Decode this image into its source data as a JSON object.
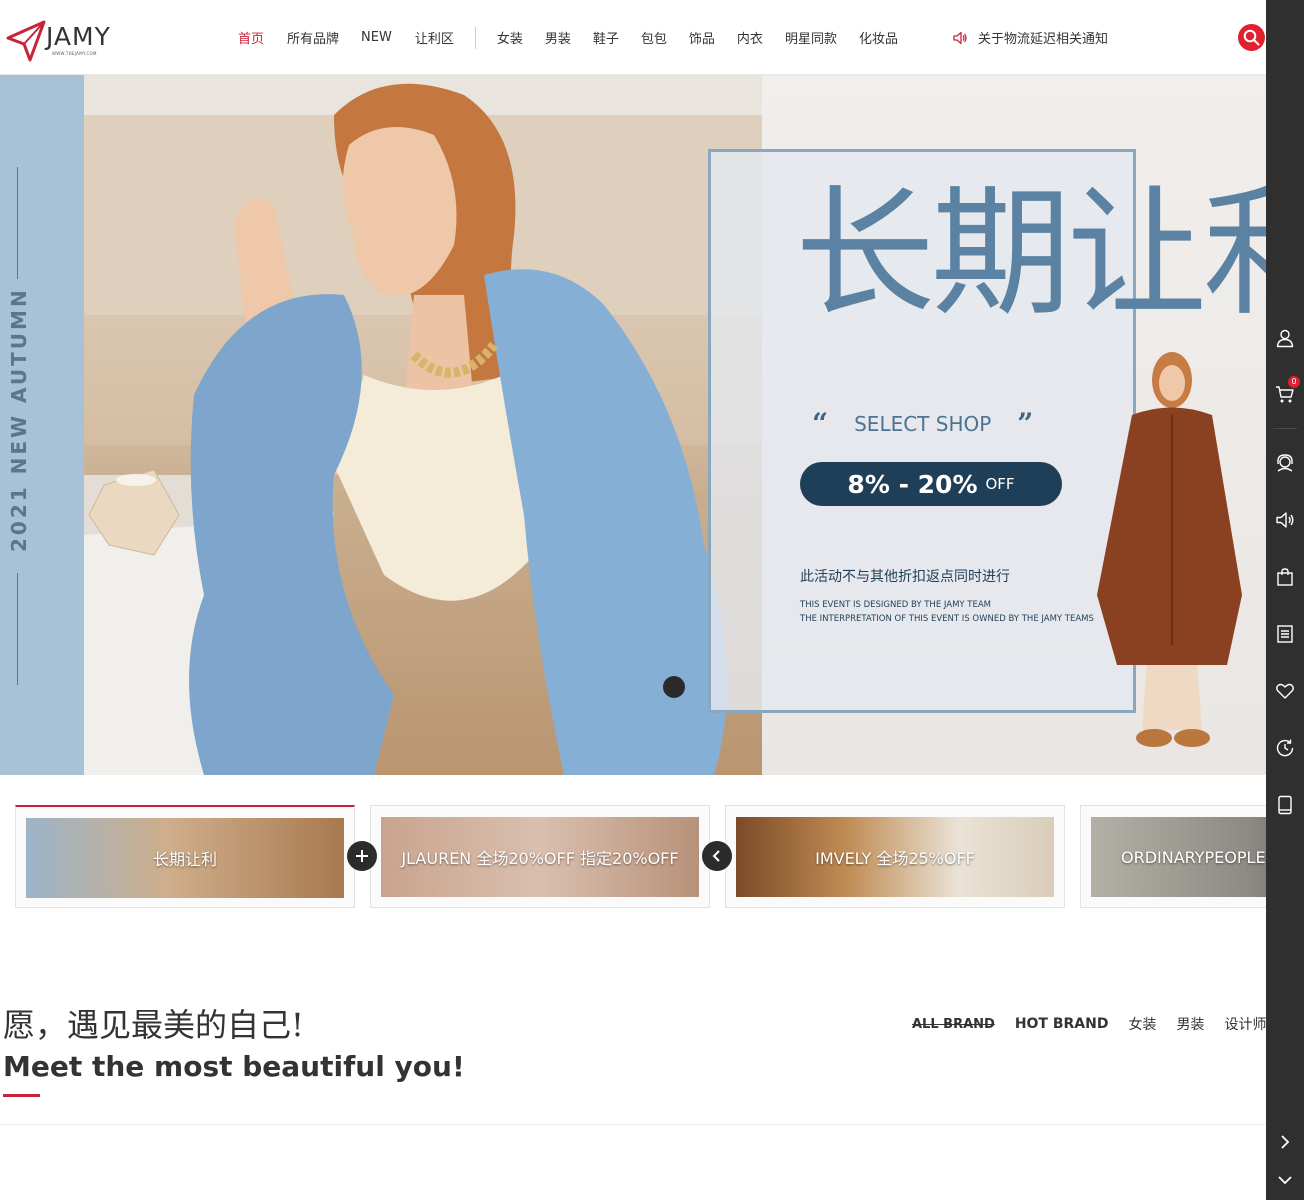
{
  "brand": {
    "name": "JAMY",
    "site": "WWW.THEJAMY.COM"
  },
  "nav": {
    "items": [
      "首页",
      "所有品牌",
      "NEW",
      "让利区",
      "女装",
      "男装",
      "鞋子",
      "包包",
      "饰品",
      "内衣",
      "明星同款",
      "化妆品"
    ],
    "active_index": 0
  },
  "notice": {
    "text": "关于物流延迟相关通知",
    "icon": "speaker-icon"
  },
  "search": {
    "icon": "search-icon"
  },
  "hero": {
    "vertical_text": "2021 NEW AUTUMN",
    "title": "长期让利",
    "select_shop": "SELECT SHOP",
    "discount": "8% - 20%",
    "discount_suffix": "OFF",
    "note": "此活动不与其他折扣返点同时进行",
    "small_line1": "THIS EVENT IS DESIGNED BY THE JAMY TEAM",
    "small_line2": "THE INTERPRETATION OF THIS EVENT IS OWNED BY THE JAMY TEAMS"
  },
  "carousel": {
    "slides": [
      "长期让利",
      "JLAUREN 全场20%OFF 指定20%OFF",
      "IMVELY 全场25%OFF",
      "ORDINARYPEOPLE"
    ]
  },
  "slogan": {
    "cn": "愿，遇见最美的自己!",
    "en": "Meet the most beautiful you!"
  },
  "brand_tabs": [
    "ALL BRAND",
    "HOT BRAND",
    "女装",
    "男装",
    "设计师"
  ],
  "dock": {
    "cart_count": "0",
    "icons": [
      "user-icon",
      "cart-icon",
      "customer-service-icon",
      "speaker-icon",
      "shopping-bag-icon",
      "list-icon",
      "heart-icon",
      "history-icon",
      "tablet-icon",
      "chevron-right-icon",
      "chevron-down-icon"
    ]
  },
  "colors": {
    "accent": "#c8233a",
    "hero_stripe": "#a7c2d6",
    "promo_blue": "#5b82a3",
    "dock": "#2f2f2f"
  }
}
